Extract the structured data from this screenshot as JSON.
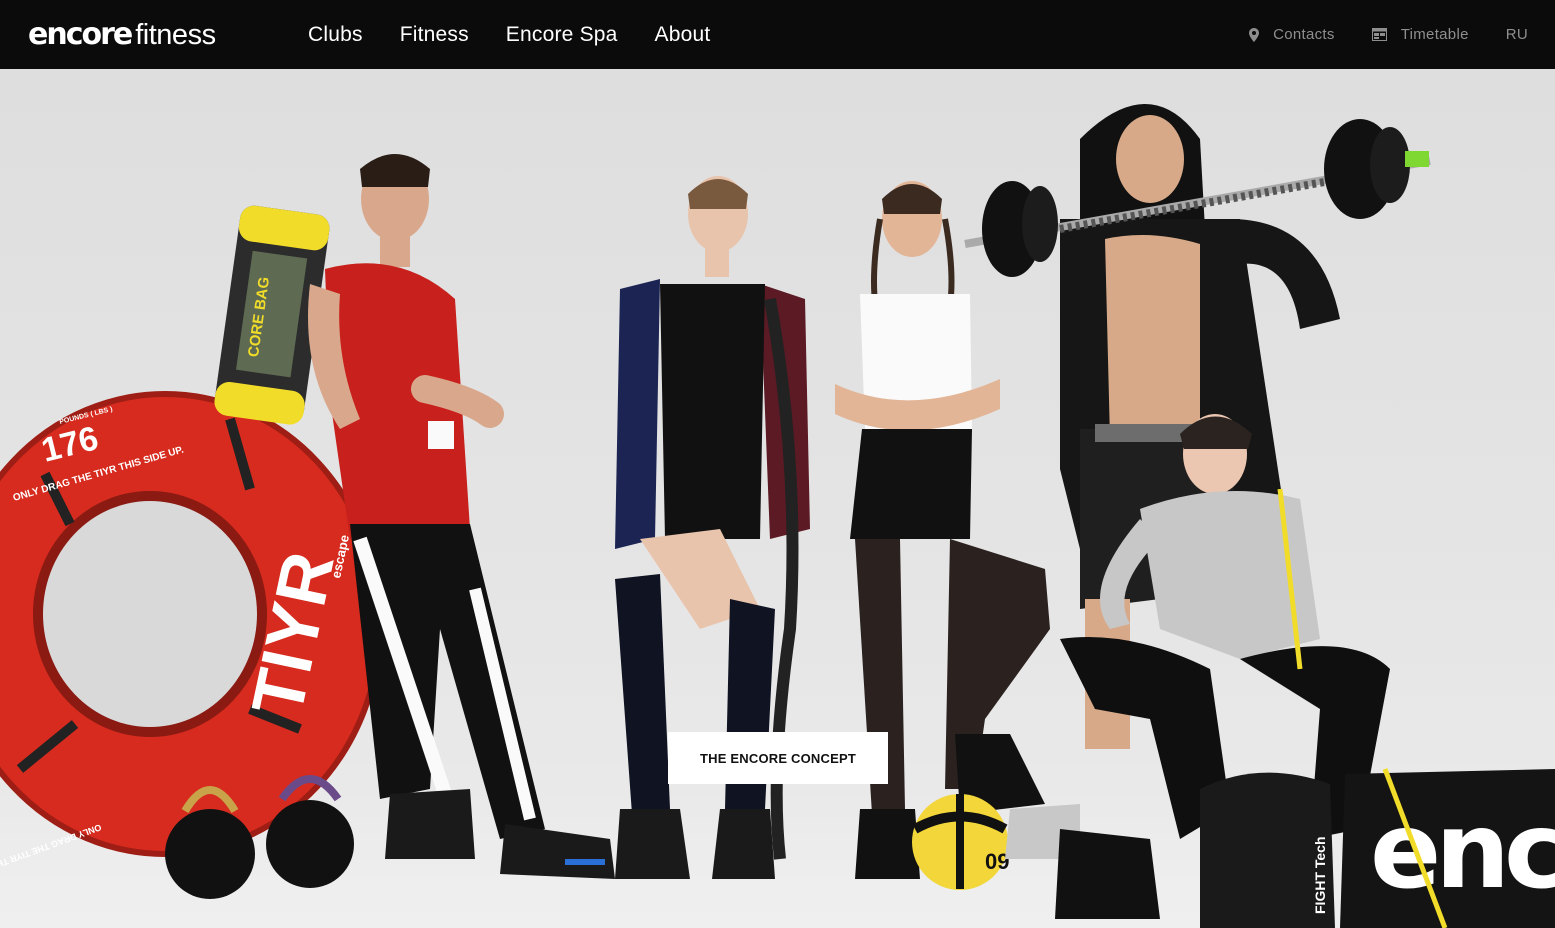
{
  "header": {
    "logo": {
      "brand": "encore",
      "suffix": "fitness"
    },
    "nav": [
      {
        "label": "Clubs"
      },
      {
        "label": "Fitness"
      },
      {
        "label": "Encore Spa"
      },
      {
        "label": "About"
      }
    ],
    "utility": {
      "contacts": {
        "label": "Contacts",
        "icon": "map-pin-icon"
      },
      "timetable": {
        "label": "Timetable",
        "icon": "calendar-icon"
      },
      "language": {
        "label": "RU"
      }
    }
  },
  "hero": {
    "cta_label": "THE ENCORE CONCEPT",
    "props": {
      "tyre_weight": "176",
      "tyre_weight_unit": "POUNDS ( LBS )",
      "tyre_slogan": "ONLY DRAG THE TIYR THIS SIDE UP.",
      "tyre_brand": "TIYR",
      "tyre_maker": "escape",
      "core_bag_label": "CORE BAG",
      "ball_number": "09",
      "bag_brand": "FIGHT Tech",
      "banner_text": "enc"
    }
  },
  "colors": {
    "header_bg": "#0b0b0b",
    "nav_text": "#ffffff",
    "utility_text": "#8e8e8e",
    "cta_bg": "#ffffff",
    "tyre_red": "#d62b1e",
    "core_bag_yellow": "#f2dc2a",
    "tank_red": "#c8201c"
  }
}
